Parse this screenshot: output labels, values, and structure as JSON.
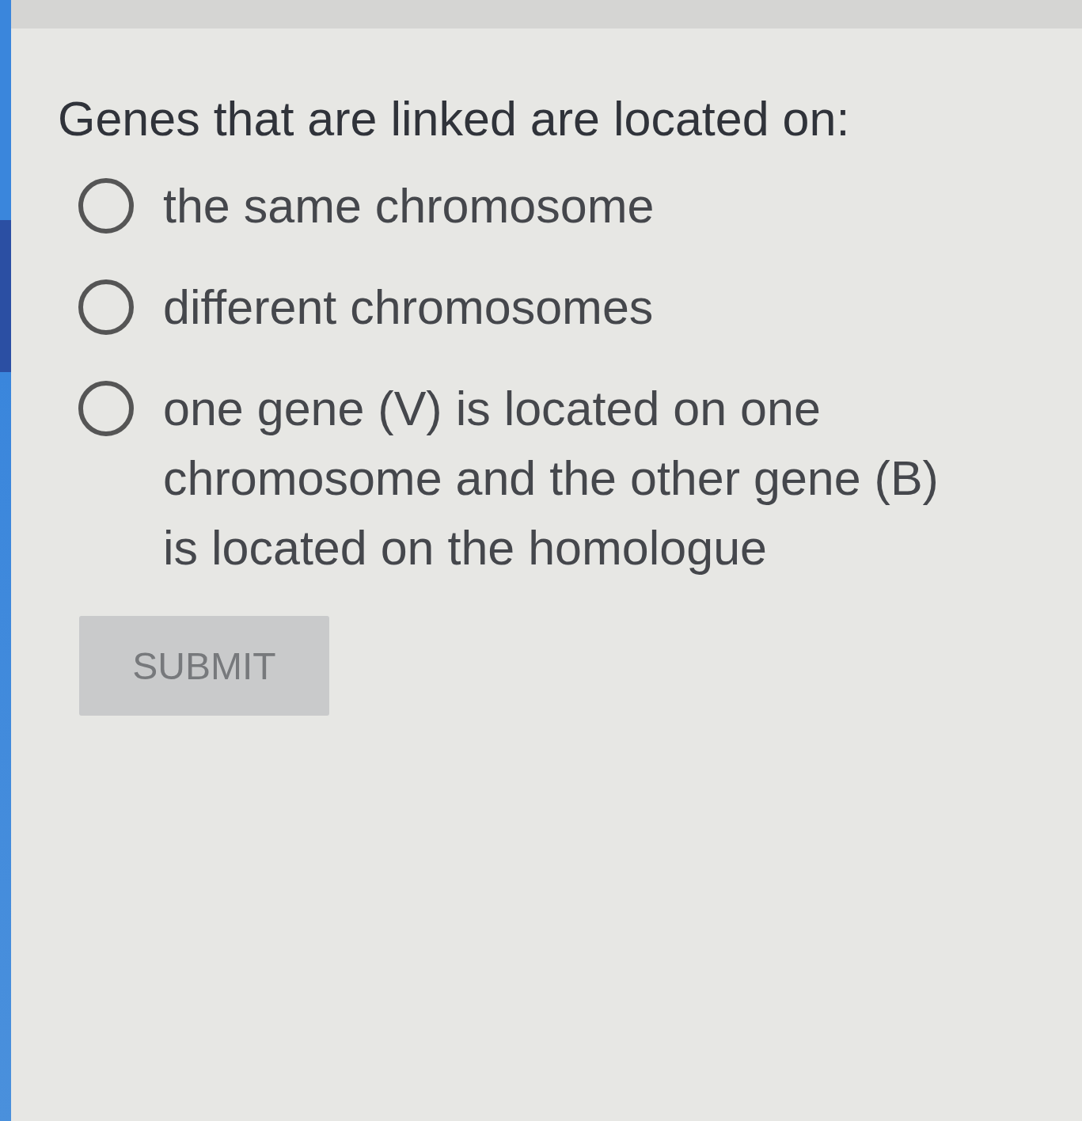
{
  "question": "Genes that are linked are located on:",
  "options": [
    {
      "label": "the same chromosome",
      "selected": false
    },
    {
      "label": "different chromosomes",
      "selected": false
    },
    {
      "label": "one gene (V) is located on one chromosome and the other gene (B) is located on the homologue",
      "selected": false
    }
  ],
  "submit_button": {
    "label": "SUBMIT",
    "disabled": true
  }
}
